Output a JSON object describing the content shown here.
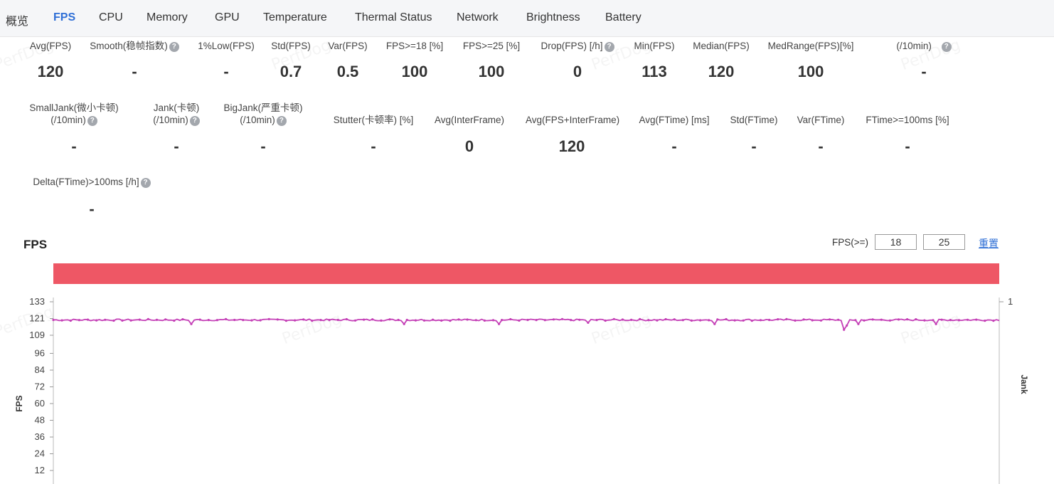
{
  "tabs": [
    {
      "label": "概览",
      "active": false
    },
    {
      "label": "FPS",
      "active": true
    },
    {
      "label": "CPU",
      "active": false
    },
    {
      "label": "Memory",
      "active": false
    },
    {
      "label": "GPU",
      "active": false
    },
    {
      "label": "Temperature",
      "active": false
    },
    {
      "label": "Thermal Status",
      "active": false
    },
    {
      "label": "Network",
      "active": false
    },
    {
      "label": "Brightness",
      "active": false
    },
    {
      "label": "Battery",
      "active": false
    }
  ],
  "watermark": "PerfDog",
  "metrics_row1": [
    {
      "label": "Avg(FPS)",
      "value": "120",
      "help": false
    },
    {
      "label": "Smooth(稳帧指数)",
      "value": "-",
      "help": true
    },
    {
      "label": "1%Low(FPS)",
      "value": "-",
      "help": false
    },
    {
      "label": "Std(FPS)",
      "value": "0.7",
      "help": false
    },
    {
      "label": "Var(FPS)",
      "value": "0.5",
      "help": false
    },
    {
      "label": "FPS>=18 [%]",
      "value": "100",
      "help": false
    },
    {
      "label": "FPS>=25 [%]",
      "value": "100",
      "help": false
    },
    {
      "label": "Drop(FPS) [/h]",
      "value": "0",
      "help": true
    },
    {
      "label": "Min(FPS)",
      "value": "113",
      "help": false
    },
    {
      "label": "Median(FPS)",
      "value": "120",
      "help": false
    },
    {
      "label": "MedRange(FPS)[%]",
      "value": "100",
      "help": false
    },
    {
      "label": "(/10min)",
      "value": "-",
      "help": true
    }
  ],
  "metrics_row2": [
    {
      "label": "SmallJank(微小卡顿)",
      "label2": "(/10min)",
      "value": "-",
      "help": true
    },
    {
      "label": "Jank(卡顿)",
      "label2": "(/10min)",
      "value": "-",
      "help": true
    },
    {
      "label": "BigJank(严重卡顿)",
      "label2": "(/10min)",
      "value": "-",
      "help": true
    },
    {
      "label": "Stutter(卡顿率) [%]",
      "value": "-",
      "help": false
    },
    {
      "label": "Avg(InterFrame)",
      "value": "0",
      "help": false
    },
    {
      "label": "Avg(FPS+InterFrame)",
      "value": "120",
      "help": false
    },
    {
      "label": "Avg(FTime) [ms]",
      "value": "-",
      "help": false
    },
    {
      "label": "Std(FTime)",
      "value": "-",
      "help": false
    },
    {
      "label": "Var(FTime)",
      "value": "-",
      "help": false
    },
    {
      "label": "FTime>=100ms [%]",
      "value": "-",
      "help": false
    }
  ],
  "metrics_row3": [
    {
      "label": "Delta(FTime)>100ms [/h]",
      "value": "-",
      "help": true
    }
  ],
  "chart": {
    "title": "FPS",
    "threshold_label": "FPS(>=)",
    "threshold_1": "18",
    "threshold_2": "25",
    "reset_label": "重置",
    "bar_color": "#ee5765",
    "line_color": "#c43fb6"
  },
  "chart_data": {
    "type": "line",
    "ylabel": "FPS",
    "y2label": "Jank",
    "yticks": [
      12,
      24,
      36,
      48,
      60,
      72,
      84,
      96,
      109,
      121,
      133
    ],
    "ylim": [
      0,
      133
    ],
    "y2ticks": [
      1
    ],
    "series": [
      {
        "baseline": 120,
        "dips": [
          [
            0.145,
            117
          ],
          [
            0.37,
            117
          ],
          [
            0.47,
            117
          ],
          [
            0.565,
            118
          ],
          [
            0.7,
            117
          ],
          [
            0.835,
            113
          ],
          [
            0.84,
            116
          ],
          [
            0.85,
            117
          ],
          [
            0.933,
            117
          ]
        ]
      }
    ]
  }
}
